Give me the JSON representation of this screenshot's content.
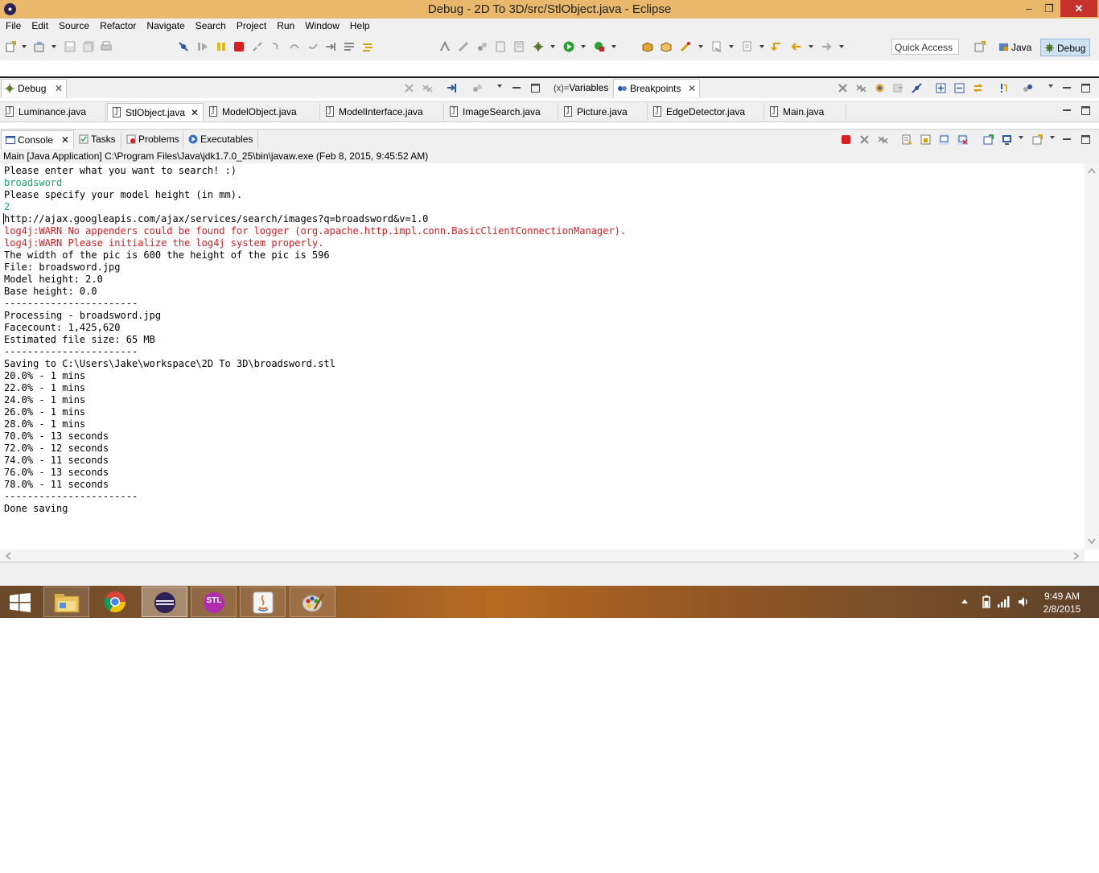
{
  "window": {
    "title": "Debug - 2D To 3D/src/StlObject.java - Eclipse",
    "minimize": "–",
    "maximize": "❐",
    "close": "✕"
  },
  "menu": [
    "File",
    "Edit",
    "Source",
    "Refactor",
    "Navigate",
    "Search",
    "Project",
    "Run",
    "Window",
    "Help"
  ],
  "toolbar": {
    "quick_access": "Quick Access",
    "perspectives": [
      "Java",
      "Debug"
    ]
  },
  "debug_view": {
    "tab": "Debug",
    "right_tabs": [
      "Variables",
      "Breakpoints"
    ],
    "variables_prefix": "(x)="
  },
  "editor_tabs": [
    "Luminance.java",
    "StlObject.java",
    "ModelObject.java",
    "ModelInterface.java",
    "ImageSearch.java",
    "Picture.java",
    "EdgeDetector.java",
    "Main.java"
  ],
  "console_view": {
    "tabs": [
      "Console",
      "Tasks",
      "Problems",
      "Executables"
    ],
    "launch": "Main [Java Application] C:\\Program Files\\Java\\jdk1.7.0_25\\bin\\javaw.exe (Feb 8, 2015, 9:45:52 AM)",
    "lines": [
      {
        "text": "Please enter what you want to search! :)",
        "kind": "out"
      },
      {
        "text": "broadsword",
        "kind": "in"
      },
      {
        "text": "Please specify your model height (in mm).",
        "kind": "out"
      },
      {
        "text": "2",
        "kind": "in"
      },
      {
        "text": "http://ajax.googleapis.com/ajax/services/search/images?q=broadsword&v=1.0",
        "kind": "out"
      },
      {
        "text": "log4j:WARN No appenders could be found for logger (org.apache.http.impl.conn.BasicClientConnectionManager).",
        "kind": "err"
      },
      {
        "text": "log4j:WARN Please initialize the log4j system properly.",
        "kind": "err"
      },
      {
        "text": "The width of the pic is 600 the height of the pic is 596",
        "kind": "out"
      },
      {
        "text": "File: broadsword.jpg",
        "kind": "out"
      },
      {
        "text": "Model height: 2.0",
        "kind": "out"
      },
      {
        "text": "Base height: 0.0",
        "kind": "out"
      },
      {
        "text": "-----------------------",
        "kind": "out"
      },
      {
        "text": "Processing - broadsword.jpg",
        "kind": "out"
      },
      {
        "text": "Facecount: 1,425,620",
        "kind": "out"
      },
      {
        "text": "Estimated file size: 65 MB",
        "kind": "out"
      },
      {
        "text": "-----------------------",
        "kind": "out"
      },
      {
        "text": "Saving to C:\\Users\\Jake\\workspace\\2D To 3D\\broadsword.stl",
        "kind": "out"
      },
      {
        "text": "20.0% - 1 mins",
        "kind": "out"
      },
      {
        "text": "22.0% - 1 mins",
        "kind": "out"
      },
      {
        "text": "24.0% - 1 mins",
        "kind": "out"
      },
      {
        "text": "26.0% - 1 mins",
        "kind": "out"
      },
      {
        "text": "28.0% - 1 mins",
        "kind": "out"
      },
      {
        "text": "70.0% - 13 seconds",
        "kind": "out"
      },
      {
        "text": "72.0% - 12 seconds",
        "kind": "out"
      },
      {
        "text": "74.0% - 11 seconds",
        "kind": "out"
      },
      {
        "text": "76.0% - 13 seconds",
        "kind": "out"
      },
      {
        "text": "78.0% - 11 seconds",
        "kind": "out"
      },
      {
        "text": "-----------------------",
        "kind": "out"
      },
      {
        "text": "Done saving",
        "kind": "out"
      }
    ]
  },
  "taskbar": {
    "time": "9:49 AM",
    "date": "2/8/2015",
    "stl_label": "STL"
  },
  "colors": {
    "titlebar": "#e9b86a",
    "console_input": "#17a86e",
    "console_error": "#e0191d",
    "perspective_active": "#cfe2f3"
  }
}
